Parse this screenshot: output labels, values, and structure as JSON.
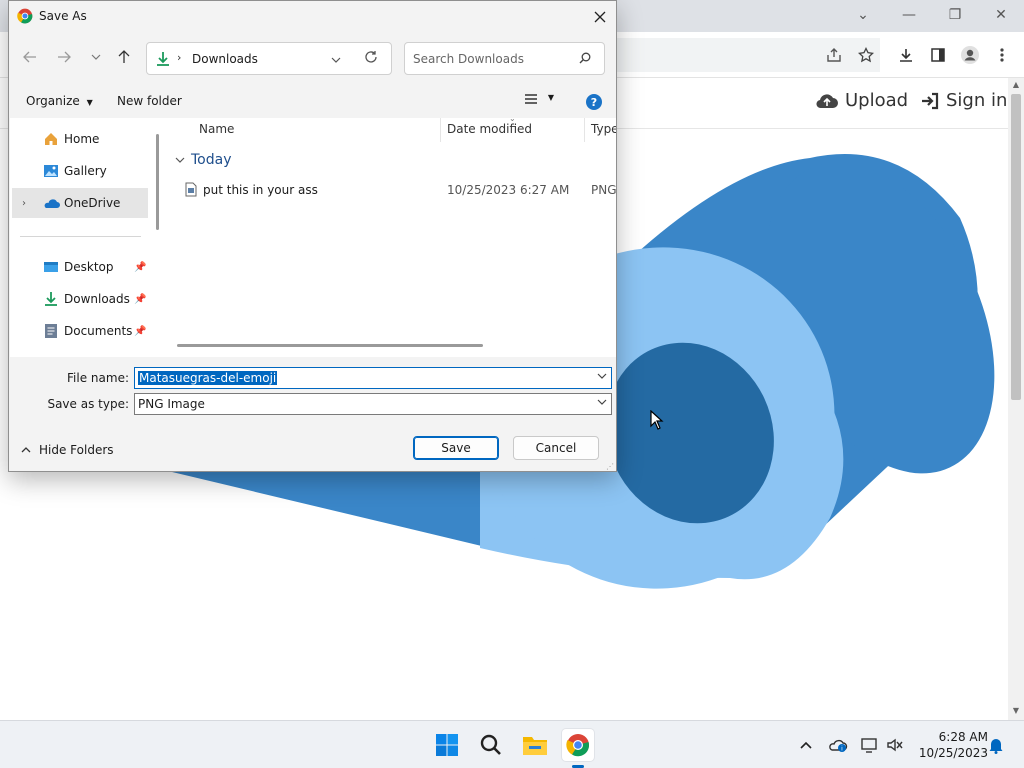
{
  "browser": {
    "header": {
      "upload_label": "Upload",
      "signin_label": "Sign in"
    },
    "colors": {
      "hero_outer": "#3a86c8",
      "hero_ring": "#8cc4f3",
      "hero_inner": "#246aa3"
    }
  },
  "dialog": {
    "title": "Save As",
    "path": {
      "folder": "Downloads"
    },
    "search": {
      "placeholder": "Search Downloads"
    },
    "commands": {
      "organize": "Organize",
      "new_folder": "New folder"
    },
    "nav_pane": {
      "items": [
        {
          "label": "Home",
          "icon": "home-icon"
        },
        {
          "label": "Gallery",
          "icon": "gallery-icon"
        },
        {
          "label": "OneDrive",
          "icon": "onedrive-icon",
          "selected": true
        },
        {
          "label": "Desktop",
          "icon": "desktop-icon",
          "pinned": true
        },
        {
          "label": "Downloads",
          "icon": "downloads-icon",
          "pinned": true
        },
        {
          "label": "Documents",
          "icon": "documents-icon",
          "pinned": true
        }
      ]
    },
    "columns": {
      "name": "Name",
      "date": "Date modified",
      "type": "Type"
    },
    "group": "Today",
    "files": [
      {
        "name": "put this in your ass",
        "date": "10/25/2023 6:27 AM",
        "type": "PNG"
      }
    ],
    "form": {
      "file_name_label": "File name:",
      "file_name_value": "Matasuegras-del-emoji",
      "save_type_label": "Save as type:",
      "save_type_value": "PNG Image"
    },
    "buttons": {
      "save": "Save",
      "cancel": "Cancel",
      "hide_folders": "Hide Folders"
    }
  },
  "taskbar": {
    "time": "6:28 AM",
    "date": "10/25/2023"
  }
}
